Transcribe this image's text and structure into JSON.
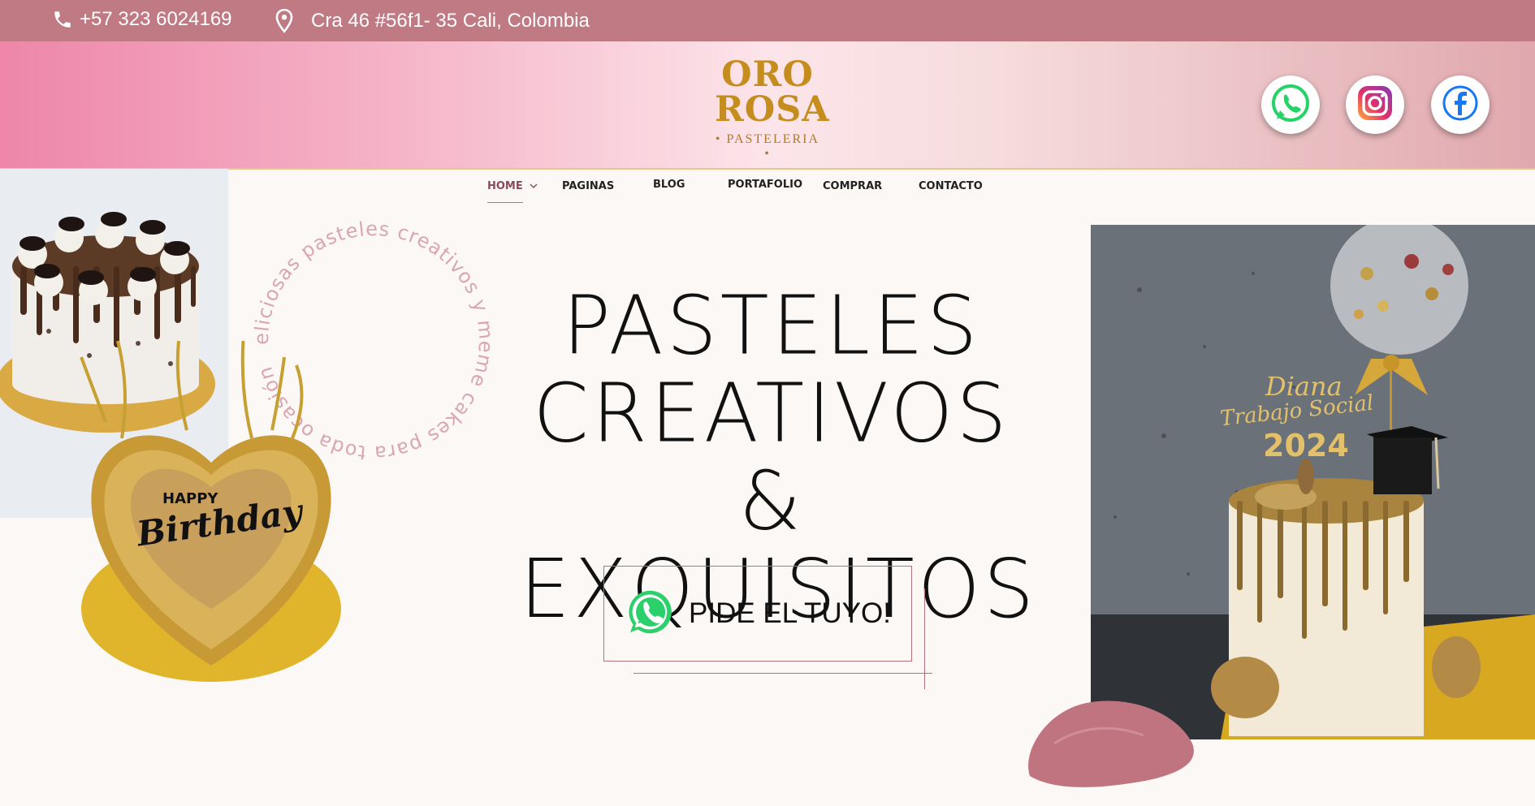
{
  "topbar": {
    "phone": "+57 323 6024169",
    "address": "Cra 46 #56f1- 35 Cali, Colombia",
    "phone_icon": "phone-icon",
    "location_icon": "location-pin-icon"
  },
  "logo": {
    "line1": "ORO",
    "line2": "ROSA",
    "line3": "• PASTELERIA •"
  },
  "social": [
    {
      "name": "whatsapp",
      "icon": "whatsapp-icon",
      "color": "#25d366"
    },
    {
      "name": "instagram",
      "icon": "instagram-icon",
      "color": "#d6249f"
    },
    {
      "name": "facebook",
      "icon": "facebook-icon",
      "color": "#1877f2"
    }
  ],
  "nav": {
    "home": "HOME",
    "paginas": "PAGINAS",
    "blog": "BLOG",
    "portafolio": "PORTAFOLIO",
    "comprar": "COMPRAR",
    "contacto": "CONTACTO"
  },
  "hero": {
    "circle_text": "Deliciosas pasteles creativos y meme cakes para toda ocasión",
    "title_line1": "PASTELES",
    "title_line2": "CREATIVOS &",
    "title_line3": "EXQUISITOS",
    "cta_label": "PIDE EL TUYO!"
  },
  "cake_topper": {
    "name": "Diana",
    "subtitle": "Trabajo Social",
    "year": "2024"
  },
  "birthday_topper": {
    "line1": "HAPPY",
    "line2": "Birthday"
  },
  "colors": {
    "topbar": "#bf7a84",
    "accent_gold": "#c48d1e",
    "accent_rose": "#b9707e"
  }
}
